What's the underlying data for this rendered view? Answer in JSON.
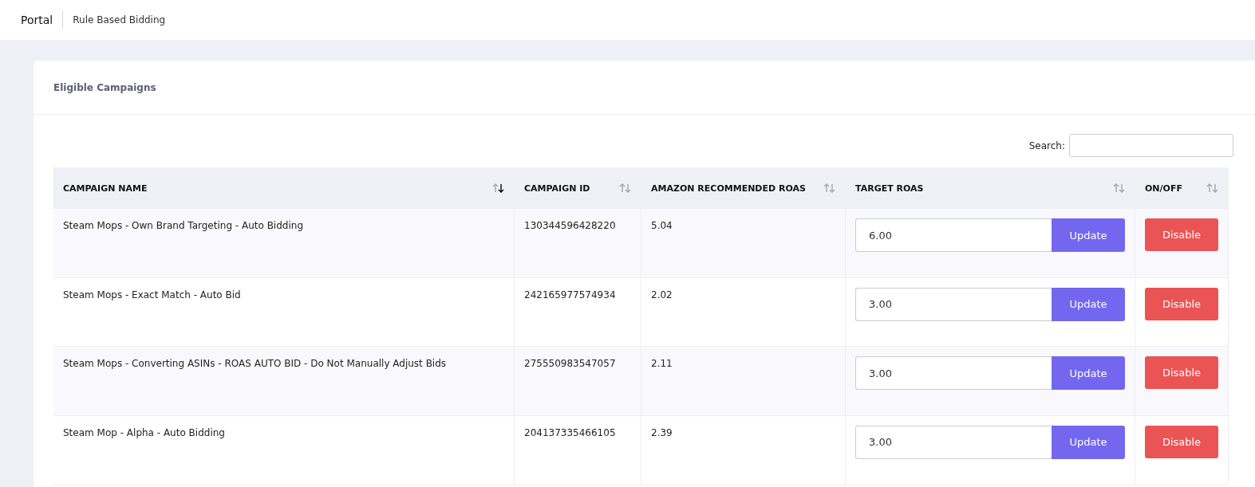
{
  "topbar": {
    "brand": "Portal",
    "page_title": "Rule Based Bidding"
  },
  "card": {
    "title": "Eligible Campaigns"
  },
  "search": {
    "label": "Search:"
  },
  "table": {
    "columns": [
      {
        "label": "CAMPAIGN NAME",
        "sorted_desc": true
      },
      {
        "label": "CAMPAIGN ID",
        "sorted_desc": false
      },
      {
        "label": "AMAZON RECOMMENDED ROAS",
        "sorted_desc": false
      },
      {
        "label": "TARGET ROAS",
        "sorted_desc": false
      },
      {
        "label": "ON/OFF",
        "sorted_desc": false
      }
    ],
    "rows": [
      {
        "name": "Steam Mops - Own Brand Targeting - Auto Bidding",
        "id": "130344596428220",
        "recommended": "5.04",
        "target": "6.00",
        "update": "Update",
        "toggle": "Disable"
      },
      {
        "name": "Steam Mops - Exact Match - Auto Bid",
        "id": "242165977574934",
        "recommended": "2.02",
        "target": "3.00",
        "update": "Update",
        "toggle": "Disable"
      },
      {
        "name": "Steam Mops - Converting ASINs - ROAS AUTO BID - Do Not Manually Adjust Bids",
        "id": "275550983547057",
        "recommended": "2.11",
        "target": "3.00",
        "update": "Update",
        "toggle": "Disable"
      },
      {
        "name": "Steam Mop - Alpha - Auto Bidding",
        "id": "204137335466105",
        "recommended": "2.39",
        "target": "3.00",
        "update": "Update",
        "toggle": "Disable"
      }
    ]
  }
}
